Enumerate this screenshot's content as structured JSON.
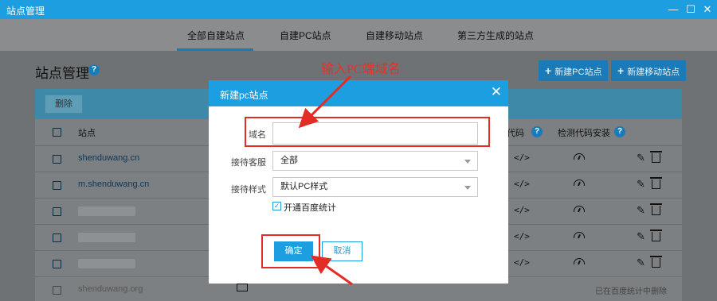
{
  "window": {
    "title": "站点管理",
    "minimize_glyph": "—",
    "maximize_glyph": "☐",
    "close_glyph": "✕"
  },
  "tabs": [
    {
      "label": "全部自建站点",
      "active": true
    },
    {
      "label": "自建PC站点",
      "active": false
    },
    {
      "label": "自建移动站点",
      "active": false
    },
    {
      "label": "第三方生成的站点",
      "active": false
    }
  ],
  "header": {
    "title": "站点管理",
    "help_glyph": "?",
    "new_pc_label": "新建PC站点",
    "new_mobile_label": "新建移动站点",
    "plus_glyph": "+"
  },
  "toolbar": {
    "delete_label": "删除"
  },
  "table": {
    "columns": {
      "site": "站点",
      "code": "代码",
      "check_install": "检测代码安装"
    },
    "code_glyph": "</>",
    "pencil_glyph": "✎",
    "rows": [
      {
        "site": "shenduwang.cn",
        "blurred": false
      },
      {
        "site": "m.shenduwang.cn",
        "blurred": false
      },
      {
        "site": "",
        "blurred": true
      },
      {
        "site": "",
        "blurred": true
      },
      {
        "site": "",
        "blurred": true
      }
    ],
    "last_row": {
      "site": "shenduwang.org",
      "note": "已在百度统计中删除"
    }
  },
  "annotation": {
    "text": "输入PC端域名",
    "color": "#e8302a"
  },
  "modal": {
    "title": "新建pc站点",
    "close_glyph": "✕",
    "domain_label": "域名",
    "domain_value": "",
    "service_label": "接待客服",
    "service_value": "全部",
    "style_label": "接待样式",
    "style_value": "默认PC样式",
    "checkbox_label": "开通百度统计",
    "checkbox_checked": true,
    "check_glyph": "✓",
    "ok_label": "确定",
    "cancel_label": "取消"
  },
  "colors": {
    "accent": "#1d9ee0",
    "highlight_red": "#e22d26"
  }
}
